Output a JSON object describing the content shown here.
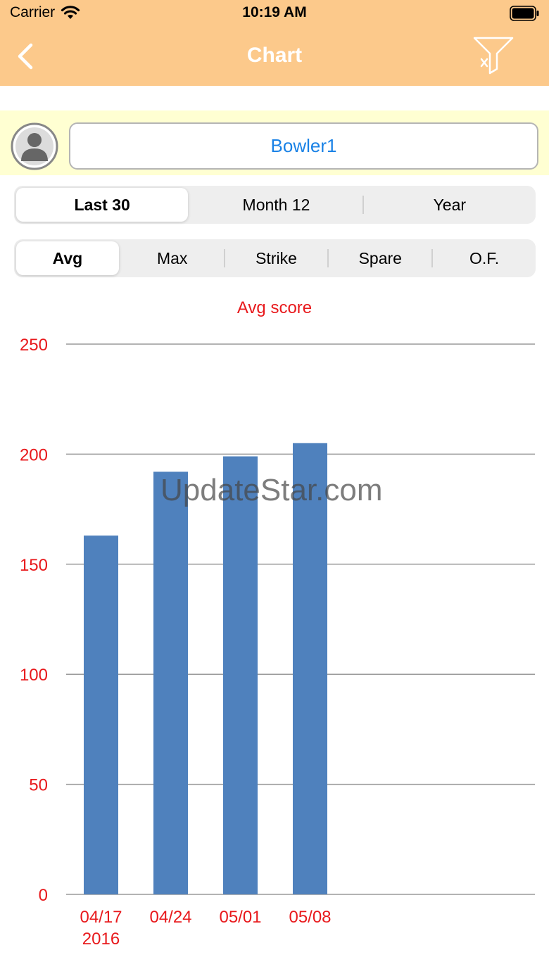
{
  "status_bar": {
    "carrier": "Carrier",
    "time": "10:19 AM"
  },
  "nav": {
    "title": "Chart",
    "back_icon": "chevron-left-icon",
    "filter_icon": "filter-clear-icon"
  },
  "bowler": {
    "name": "Bowler1",
    "avatar_icon": "person-avatar-icon"
  },
  "range_tabs": {
    "items": [
      "Last 30",
      "Month 12",
      "Year"
    ],
    "selected": "Last 30"
  },
  "metric_tabs": {
    "items": [
      "Avg",
      "Max",
      "Strike",
      "Spare",
      "O.F."
    ],
    "selected": "Avg"
  },
  "watermark": "UpdateStar.com",
  "colors": {
    "header": "#fcc98b",
    "bowler_strip": "#ffffd2",
    "bar": "#4f81bd",
    "axis_text": "#e8191c",
    "link": "#1a82e6"
  },
  "chart_data": {
    "type": "bar",
    "title": "Avg score",
    "categories": [
      {
        "line1": "04/17",
        "line2": "2016"
      },
      {
        "line1": "04/24",
        "line2": ""
      },
      {
        "line1": "05/01",
        "line2": ""
      },
      {
        "line1": "05/08",
        "line2": ""
      }
    ],
    "values": [
      163,
      192,
      199,
      205
    ],
    "ylim": [
      0,
      250
    ],
    "yticks": [
      0,
      50,
      100,
      150,
      200,
      250
    ],
    "grid": true
  }
}
